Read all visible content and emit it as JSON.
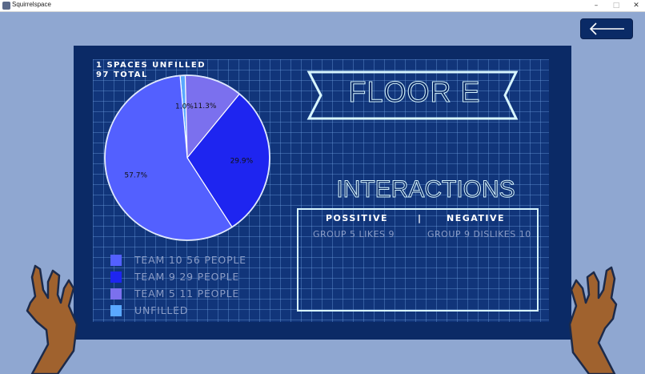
{
  "window": {
    "title": "Squirrelspace",
    "minimize": "–",
    "maximize": "□",
    "close": "✕"
  },
  "nav": {
    "back_icon": "arrow-left-icon"
  },
  "summary": {
    "unfilled": "1 SPACES UNFILLED",
    "total": "97 TOTAL"
  },
  "floor": {
    "title": "FLOOR E"
  },
  "interactions": {
    "title": "INTERACTIONS",
    "positive_header": "POSSITIVE",
    "separator": "|",
    "negative_header": "NEGATIVE",
    "positive": [
      "GROUP 5 LIKES 9"
    ],
    "negative": [
      "GROUP 9 DISLIKES 10"
    ]
  },
  "legend": [
    {
      "label": "TEAM 10   56 PEOPLE",
      "color": "#5360ff"
    },
    {
      "label": "TEAM 9   29 PEOPLE",
      "color": "#1e25f0"
    },
    {
      "label": "TEAM 5   11 PEOPLE",
      "color": "#7b70ee"
    },
    {
      "label": "UNFILLED",
      "color": "#5aa8ff"
    }
  ],
  "chart_data": {
    "type": "pie",
    "title": "",
    "slices": [
      {
        "label": "57.7%",
        "value": 57.7,
        "color": "#5360ff"
      },
      {
        "label": "29.9%",
        "value": 29.9,
        "color": "#1e25f0"
      },
      {
        "label": "11.3%",
        "value": 11.3,
        "color": "#7b70ee"
      },
      {
        "label": "1.0%",
        "value": 1.0,
        "color": "#5aa8ff"
      }
    ]
  }
}
